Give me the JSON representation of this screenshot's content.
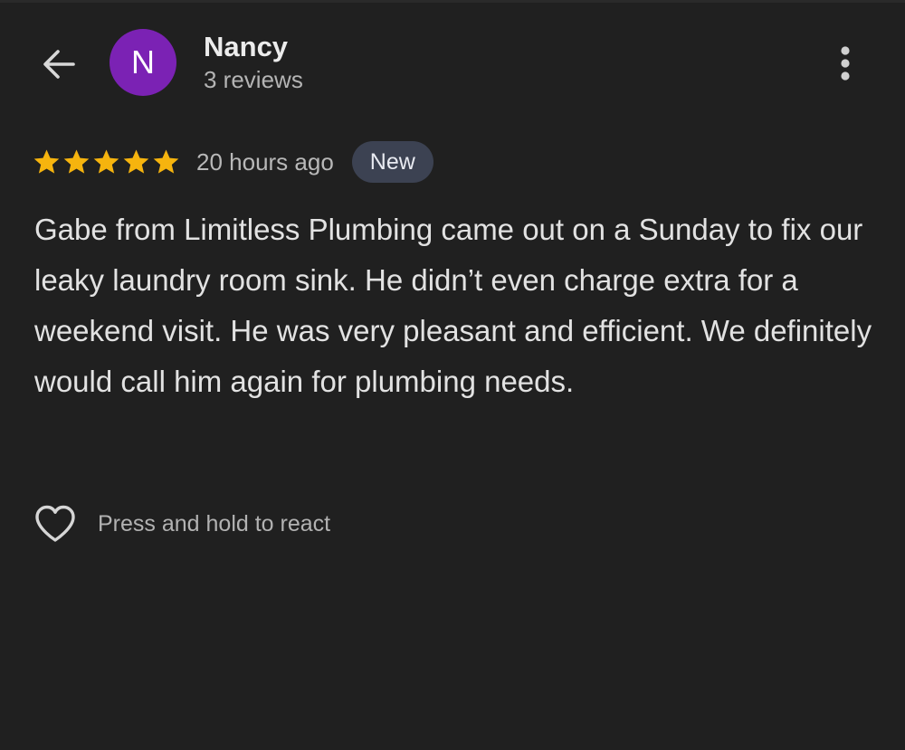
{
  "header": {
    "back_icon": "arrow-left-icon",
    "avatar_letter": "N",
    "avatar_color": "#7b22b4",
    "name": "Nancy",
    "review_count": "3 reviews",
    "more_icon": "more-vertical-icon"
  },
  "review": {
    "rating": 5,
    "rating_max": 5,
    "star_color": "#f6b40e",
    "time_ago": "20 hours ago",
    "badge": "New",
    "text": "Gabe from Limitless Plumbing came out on a Sunday to fix our leaky laundry room sink. He didn’t even charge extra for a weekend visit. He was very pleasant and efficient. We definitely would call him again for plumbing needs."
  },
  "reaction": {
    "icon": "heart-outline-icon",
    "hint": "Press and hold to react"
  }
}
